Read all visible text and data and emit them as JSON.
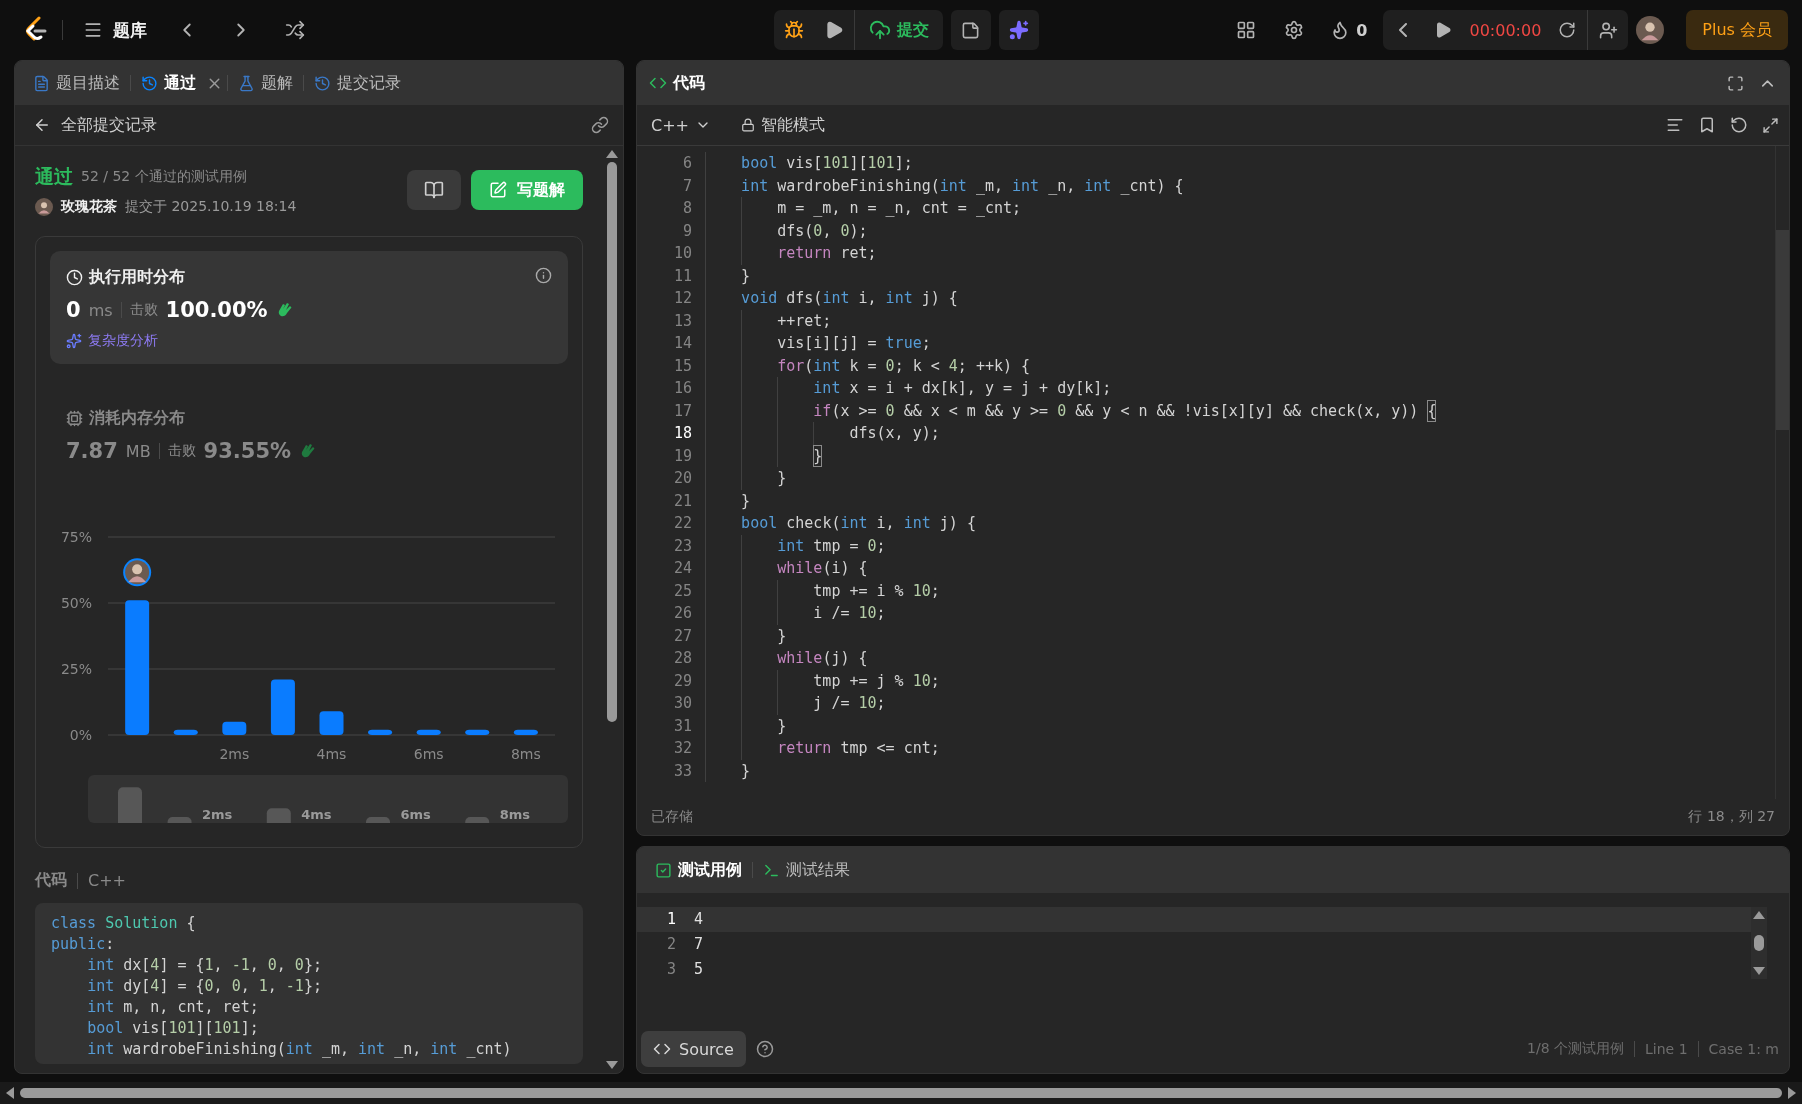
{
  "top_bar": {
    "library_label": "题库",
    "submit_label": "提交",
    "streak": "0",
    "timer": "00:00:00",
    "plus_label": "Plus 会员"
  },
  "left_panel": {
    "tabs": [
      {
        "label": "题目描述",
        "selected": false,
        "closable": false
      },
      {
        "label": "通过",
        "selected": true,
        "closable": true
      },
      {
        "label": "题解",
        "selected": false,
        "closable": false
      },
      {
        "label": "提交记录",
        "selected": false,
        "closable": false
      }
    ],
    "back_label": "全部提交记录",
    "result": {
      "status": "通过",
      "cases": "52 / 52 个通过的测试用例",
      "user": "玫瑰花茶",
      "submitted": "提交于 2025.10.19 18:14",
      "write_solution": "写题解"
    },
    "stats": [
      {
        "title": "执行用时分布",
        "value": "0",
        "unit": "ms",
        "beats_label": "击败",
        "beats": "100.00%",
        "selected": true,
        "link": "复杂度分析"
      },
      {
        "title": "消耗内存分布",
        "value": "7.87",
        "unit": "MB",
        "beats_label": "击败",
        "beats": "93.55%",
        "selected": false
      }
    ],
    "chart_data": {
      "type": "bar",
      "x": [
        0,
        1,
        2,
        3,
        4,
        5,
        6,
        7,
        8
      ],
      "values": [
        51,
        2,
        5,
        21,
        9,
        2,
        2,
        2,
        2
      ],
      "xlim": [
        -0.6,
        8.6
      ],
      "ylim": [
        0,
        75
      ],
      "xticks": [
        {
          "value": 2,
          "label": "2ms"
        },
        {
          "value": 4,
          "label": "4ms"
        },
        {
          "value": 6,
          "label": "6ms"
        },
        {
          "value": 8,
          "label": "8ms"
        }
      ],
      "yticks": [
        {
          "value": 75,
          "label": "75%"
        },
        {
          "value": 50,
          "label": "50%"
        },
        {
          "value": 25,
          "label": "25%"
        },
        {
          "value": 0,
          "label": "0%"
        }
      ]
    },
    "overview_labels": [
      "2ms",
      "4ms",
      "6ms",
      "8ms"
    ],
    "code_title": "代码",
    "code_lang": "C++",
    "code": [
      [
        {
          "kind": "kw",
          "text": "class"
        },
        {
          "kind": "type",
          "text": " Solution"
        },
        {
          "kind": "txt",
          "text": " {"
        }
      ],
      [
        {
          "kind": "kw",
          "text": "public"
        },
        {
          "kind": "txt",
          "text": ":"
        }
      ],
      [
        {
          "kind": "kw",
          "text": "    int"
        },
        {
          "kind": "txt",
          "text": " dx["
        },
        {
          "kind": "num",
          "text": "4"
        },
        {
          "kind": "txt",
          "text": "] = {"
        },
        {
          "kind": "num",
          "text": "1"
        },
        {
          "kind": "txt",
          "text": ", "
        },
        {
          "kind": "num",
          "text": "-1"
        },
        {
          "kind": "txt",
          "text": ", "
        },
        {
          "kind": "num",
          "text": "0"
        },
        {
          "kind": "txt",
          "text": ", "
        },
        {
          "kind": "num",
          "text": "0"
        },
        {
          "kind": "txt",
          "text": "};"
        }
      ],
      [
        {
          "kind": "kw",
          "text": "    int"
        },
        {
          "kind": "txt",
          "text": " dy["
        },
        {
          "kind": "num",
          "text": "4"
        },
        {
          "kind": "txt",
          "text": "] = {"
        },
        {
          "kind": "num",
          "text": "0"
        },
        {
          "kind": "txt",
          "text": ", "
        },
        {
          "kind": "num",
          "text": "0"
        },
        {
          "kind": "txt",
          "text": ", "
        },
        {
          "kind": "num",
          "text": "1"
        },
        {
          "kind": "txt",
          "text": ", "
        },
        {
          "kind": "num",
          "text": "-1"
        },
        {
          "kind": "txt",
          "text": "};"
        }
      ],
      [
        {
          "kind": "kw",
          "text": "    int"
        },
        {
          "kind": "txt",
          "text": " m, n, cnt, ret;"
        }
      ],
      [
        {
          "kind": "kw",
          "text": "    bool"
        },
        {
          "kind": "txt",
          "text": " vis["
        },
        {
          "kind": "num",
          "text": "101"
        },
        {
          "kind": "txt",
          "text": "]["
        },
        {
          "kind": "num",
          "text": "101"
        },
        {
          "kind": "txt",
          "text": "];"
        }
      ],
      [
        {
          "kind": "kw",
          "text": "    int"
        },
        {
          "kind": "txt",
          "text": " wardrobeFinishing("
        },
        {
          "kind": "kw",
          "text": "int"
        },
        {
          "kind": "txt",
          "text": " _m, "
        },
        {
          "kind": "kw",
          "text": "int"
        },
        {
          "kind": "txt",
          "text": " _n, "
        },
        {
          "kind": "kw",
          "text": "int"
        },
        {
          "kind": "txt",
          "text": " _cnt)"
        }
      ]
    ]
  },
  "editor": {
    "title": "代码",
    "language": "C++",
    "mode": "智能模式",
    "saved": "已存储",
    "position": "行 18，列 27",
    "lines": [
      {
        "number": "6",
        "selected": false,
        "tokens": [
          {
            "kind": "kw",
            "text": "    bool"
          },
          {
            "kind": "txt",
            "text": " vis["
          },
          {
            "kind": "num",
            "text": "101"
          },
          {
            "kind": "txt",
            "text": "]["
          },
          {
            "kind": "num",
            "text": "101"
          },
          {
            "kind": "txt",
            "text": "];"
          }
        ]
      },
      {
        "number": "7",
        "selected": false,
        "tokens": [
          {
            "kind": "kw",
            "text": "    int"
          },
          {
            "kind": "txt",
            "text": " wardrobeFinishing("
          },
          {
            "kind": "kw",
            "text": "int"
          },
          {
            "kind": "txt",
            "text": " _m, "
          },
          {
            "kind": "kw",
            "text": "int"
          },
          {
            "kind": "txt",
            "text": " _n, "
          },
          {
            "kind": "kw",
            "text": "int"
          },
          {
            "kind": "txt",
            "text": " _cnt) {"
          }
        ]
      },
      {
        "number": "8",
        "selected": false,
        "tokens": [
          {
            "kind": "txt",
            "text": "        m = _m, n = _n, cnt = _cnt;"
          }
        ]
      },
      {
        "number": "9",
        "selected": false,
        "tokens": [
          {
            "kind": "txt",
            "text": "        dfs("
          },
          {
            "kind": "num",
            "text": "0"
          },
          {
            "kind": "txt",
            "text": ", "
          },
          {
            "kind": "num",
            "text": "0"
          },
          {
            "kind": "txt",
            "text": ");"
          }
        ]
      },
      {
        "number": "10",
        "selected": false,
        "tokens": [
          {
            "kind": "ctl",
            "text": "        return"
          },
          {
            "kind": "txt",
            "text": " ret;"
          }
        ]
      },
      {
        "number": "11",
        "selected": false,
        "tokens": [
          {
            "kind": "txt",
            "text": "    }"
          }
        ]
      },
      {
        "number": "12",
        "selected": false,
        "tokens": [
          {
            "kind": "kw",
            "text": "    void"
          },
          {
            "kind": "txt",
            "text": " dfs("
          },
          {
            "kind": "kw",
            "text": "int"
          },
          {
            "kind": "txt",
            "text": " i, "
          },
          {
            "kind": "kw",
            "text": "int"
          },
          {
            "kind": "txt",
            "text": " j) {"
          }
        ]
      },
      {
        "number": "13",
        "selected": false,
        "tokens": [
          {
            "kind": "txt",
            "text": "        ++ret;"
          }
        ]
      },
      {
        "number": "14",
        "selected": false,
        "tokens": [
          {
            "kind": "txt",
            "text": "        vis[i][j] = "
          },
          {
            "kind": "kw",
            "text": "true"
          },
          {
            "kind": "txt",
            "text": ";"
          }
        ]
      },
      {
        "number": "15",
        "selected": false,
        "tokens": [
          {
            "kind": "ctl",
            "text": "        for"
          },
          {
            "kind": "txt",
            "text": "("
          },
          {
            "kind": "kw",
            "text": "int"
          },
          {
            "kind": "txt",
            "text": " k = "
          },
          {
            "kind": "num",
            "text": "0"
          },
          {
            "kind": "txt",
            "text": "; k < "
          },
          {
            "kind": "num",
            "text": "4"
          },
          {
            "kind": "txt",
            "text": "; ++k) {"
          }
        ]
      },
      {
        "number": "16",
        "selected": false,
        "tokens": [
          {
            "kind": "kw",
            "text": "            int"
          },
          {
            "kind": "txt",
            "text": " x = i + dx[k], y = j + dy[k];"
          }
        ]
      },
      {
        "number": "17",
        "selected": false,
        "tokens": [
          {
            "kind": "ctl",
            "text": "            if"
          },
          {
            "kind": "txt",
            "text": "(x >= "
          },
          {
            "kind": "num",
            "text": "0"
          },
          {
            "kind": "txt",
            "text": " && x < m && y >= "
          },
          {
            "kind": "num",
            "text": "0"
          },
          {
            "kind": "txt",
            "text": " && y < n && !vis[x][y] && check(x, y)) "
          },
          {
            "kind": "match",
            "text": "{"
          }
        ]
      },
      {
        "number": "18",
        "selected": true,
        "tokens": [
          {
            "kind": "txt",
            "text": "                dfs(x, y);"
          }
        ]
      },
      {
        "number": "19",
        "selected": false,
        "tokens": [
          {
            "kind": "match",
            "text": "            }"
          }
        ]
      },
      {
        "number": "20",
        "selected": false,
        "tokens": [
          {
            "kind": "txt",
            "text": "        }"
          }
        ]
      },
      {
        "number": "21",
        "selected": false,
        "tokens": [
          {
            "kind": "txt",
            "text": "    }"
          }
        ]
      },
      {
        "number": "22",
        "selected": false,
        "tokens": [
          {
            "kind": "kw",
            "text": "    bool"
          },
          {
            "kind": "txt",
            "text": " check("
          },
          {
            "kind": "kw",
            "text": "int"
          },
          {
            "kind": "txt",
            "text": " i, "
          },
          {
            "kind": "kw",
            "text": "int"
          },
          {
            "kind": "txt",
            "text": " j) {"
          }
        ]
      },
      {
        "number": "23",
        "selected": false,
        "tokens": [
          {
            "kind": "kw",
            "text": "        int"
          },
          {
            "kind": "txt",
            "text": " tmp = "
          },
          {
            "kind": "num",
            "text": "0"
          },
          {
            "kind": "txt",
            "text": ";"
          }
        ]
      },
      {
        "number": "24",
        "selected": false,
        "tokens": [
          {
            "kind": "ctl",
            "text": "        while"
          },
          {
            "kind": "txt",
            "text": "(i) {"
          }
        ]
      },
      {
        "number": "25",
        "selected": false,
        "tokens": [
          {
            "kind": "txt",
            "text": "            tmp += i % "
          },
          {
            "kind": "num",
            "text": "10"
          },
          {
            "kind": "txt",
            "text": ";"
          }
        ]
      },
      {
        "number": "26",
        "selected": false,
        "tokens": [
          {
            "kind": "txt",
            "text": "            i /= "
          },
          {
            "kind": "num",
            "text": "10"
          },
          {
            "kind": "txt",
            "text": ";"
          }
        ]
      },
      {
        "number": "27",
        "selected": false,
        "tokens": [
          {
            "kind": "txt",
            "text": "        }"
          }
        ]
      },
      {
        "number": "28",
        "selected": false,
        "tokens": [
          {
            "kind": "ctl",
            "text": "        while"
          },
          {
            "kind": "txt",
            "text": "(j) {"
          }
        ]
      },
      {
        "number": "29",
        "selected": false,
        "tokens": [
          {
            "kind": "txt",
            "text": "            tmp += j % "
          },
          {
            "kind": "num",
            "text": "10"
          },
          {
            "kind": "txt",
            "text": ";"
          }
        ]
      },
      {
        "number": "30",
        "selected": false,
        "tokens": [
          {
            "kind": "txt",
            "text": "            j /= "
          },
          {
            "kind": "num",
            "text": "10"
          },
          {
            "kind": "txt",
            "text": ";"
          }
        ]
      },
      {
        "number": "31",
        "selected": false,
        "tokens": [
          {
            "kind": "txt",
            "text": "        }"
          }
        ]
      },
      {
        "number": "32",
        "selected": false,
        "tokens": [
          {
            "kind": "ctl",
            "text": "        return"
          },
          {
            "kind": "txt",
            "text": " tmp <= cnt;"
          }
        ]
      },
      {
        "number": "33",
        "selected": false,
        "tokens": [
          {
            "kind": "txt",
            "text": "    }"
          }
        ]
      }
    ]
  },
  "test_panel": {
    "tabs": [
      {
        "label": "测试用例",
        "selected": true
      },
      {
        "label": "测试结果",
        "selected": false
      }
    ],
    "lines": [
      {
        "number": "1",
        "value": "4",
        "selected": true
      },
      {
        "number": "2",
        "value": "7",
        "selected": false
      },
      {
        "number": "3",
        "value": "5",
        "selected": false
      }
    ],
    "source_label": "Source",
    "status": [
      "1/8 个测试用例",
      "Line 1",
      "Case 1: m"
    ]
  }
}
